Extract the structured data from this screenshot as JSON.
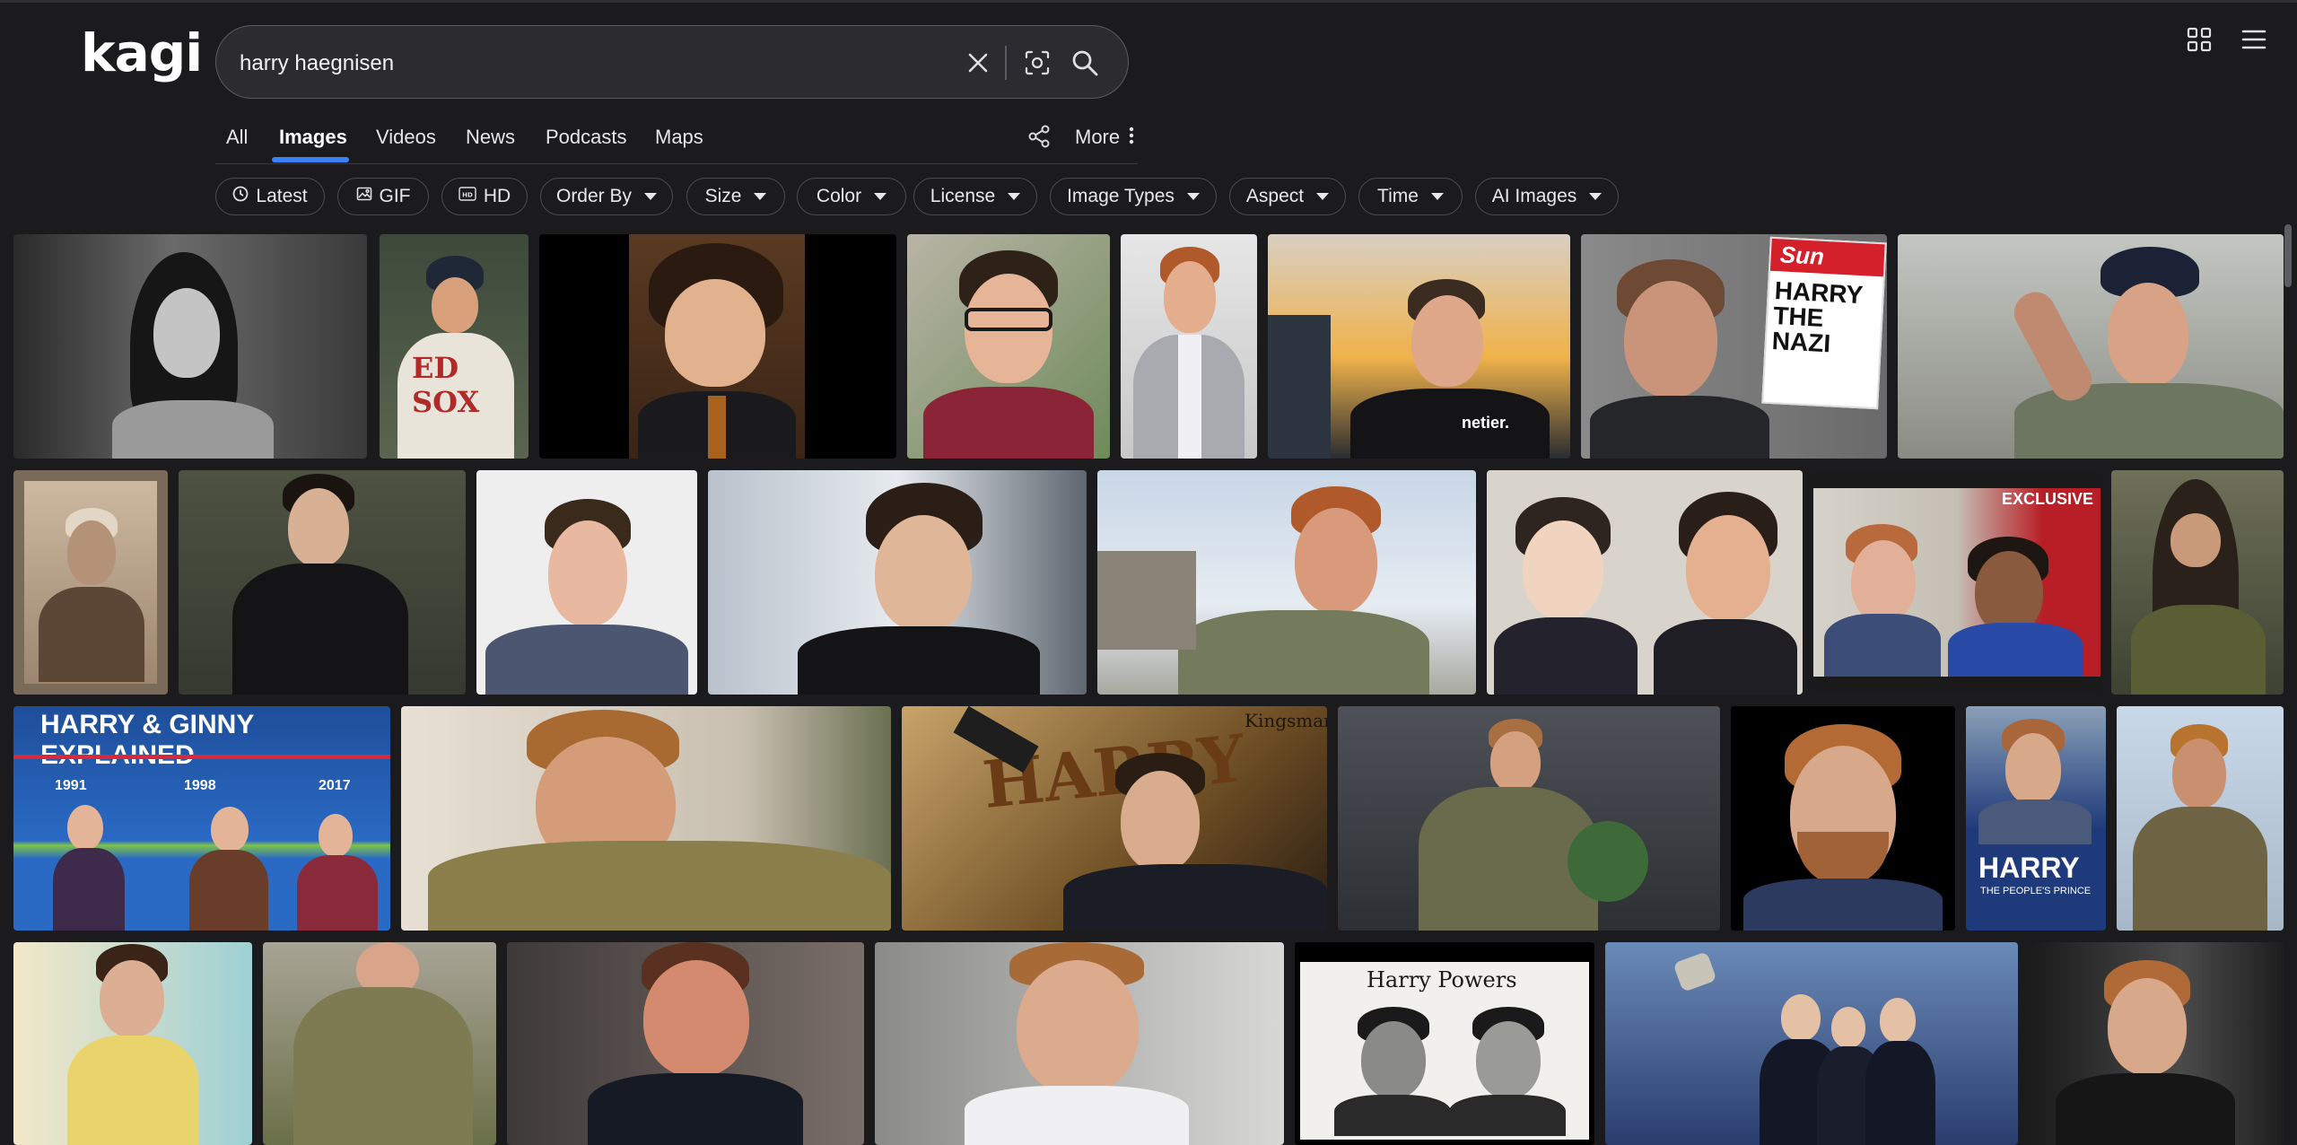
{
  "brand": {
    "logo_text": "kagi"
  },
  "search": {
    "query": "harry haegnisen"
  },
  "icons": {
    "clear": "close-icon",
    "image_search": "camera-scan-icon",
    "search": "search-icon",
    "apps": "grid-icon",
    "menu": "hamburger-menu-icon",
    "share": "share-icon",
    "more": "vertical-dots-icon"
  },
  "tabs": [
    {
      "label": "All"
    },
    {
      "label": "Images",
      "active": true
    },
    {
      "label": "Videos"
    },
    {
      "label": "News"
    },
    {
      "label": "Podcasts"
    },
    {
      "label": "Maps"
    }
  ],
  "tabs_more": {
    "label": "More"
  },
  "filters": [
    {
      "label": "Latest",
      "icon": "clock-icon"
    },
    {
      "label": "GIF",
      "icon": "image-icon"
    },
    {
      "label": "HD",
      "icon": "hd-icon"
    },
    {
      "label": "Order By",
      "dropdown": true
    },
    {
      "label": "Size",
      "dropdown": true
    },
    {
      "label": "Color",
      "dropdown": true
    },
    {
      "label": "License",
      "dropdown": true
    },
    {
      "label": "Image Types",
      "dropdown": true
    },
    {
      "label": "Aspect",
      "dropdown": true
    },
    {
      "label": "Time",
      "dropdown": true
    },
    {
      "label": "AI Images",
      "dropdown": true
    }
  ],
  "image_texts": {
    "sox": "ED SOX",
    "sun_masthead": "Sun",
    "sun_headline": "HARRY THE NAZI",
    "exclusive": "EXCLUSIVE",
    "ginny_title": "HARRY & GINNY EXPLAINED",
    "ginny_year_1": "1991",
    "ginny_year_2": "1998",
    "ginny_year_3": "2017",
    "kingsman_brand": "Kingsman",
    "kingsman_word": "HARRY",
    "book_title": "HARRY",
    "book_subtitle": "THE PEOPLE'S PRINCE",
    "powers_title": "Harry Powers",
    "suit_sponsor": "netier."
  },
  "accent_color": "#3b82f6"
}
